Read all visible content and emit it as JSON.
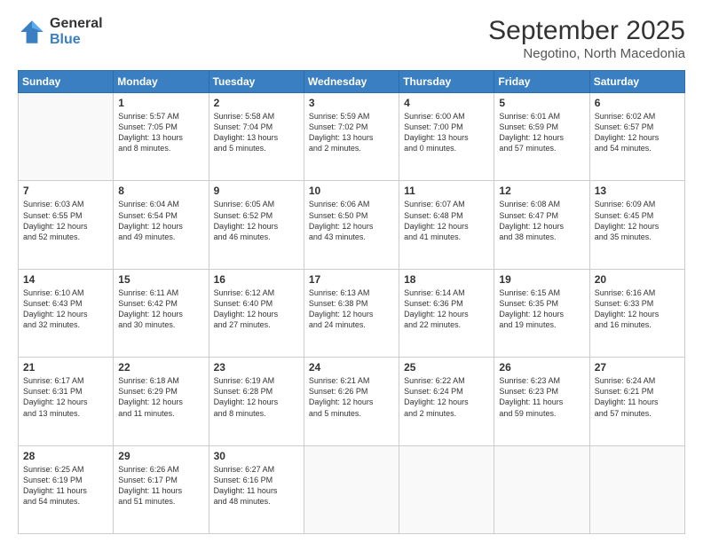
{
  "logo": {
    "general": "General",
    "blue": "Blue"
  },
  "title": {
    "month": "September 2025",
    "location": "Negotino, North Macedonia"
  },
  "weekdays": [
    "Sunday",
    "Monday",
    "Tuesday",
    "Wednesday",
    "Thursday",
    "Friday",
    "Saturday"
  ],
  "weeks": [
    [
      {
        "day": "",
        "info": ""
      },
      {
        "day": "1",
        "info": "Sunrise: 5:57 AM\nSunset: 7:05 PM\nDaylight: 13 hours\nand 8 minutes."
      },
      {
        "day": "2",
        "info": "Sunrise: 5:58 AM\nSunset: 7:04 PM\nDaylight: 13 hours\nand 5 minutes."
      },
      {
        "day": "3",
        "info": "Sunrise: 5:59 AM\nSunset: 7:02 PM\nDaylight: 13 hours\nand 2 minutes."
      },
      {
        "day": "4",
        "info": "Sunrise: 6:00 AM\nSunset: 7:00 PM\nDaylight: 13 hours\nand 0 minutes."
      },
      {
        "day": "5",
        "info": "Sunrise: 6:01 AM\nSunset: 6:59 PM\nDaylight: 12 hours\nand 57 minutes."
      },
      {
        "day": "6",
        "info": "Sunrise: 6:02 AM\nSunset: 6:57 PM\nDaylight: 12 hours\nand 54 minutes."
      }
    ],
    [
      {
        "day": "7",
        "info": "Sunrise: 6:03 AM\nSunset: 6:55 PM\nDaylight: 12 hours\nand 52 minutes."
      },
      {
        "day": "8",
        "info": "Sunrise: 6:04 AM\nSunset: 6:54 PM\nDaylight: 12 hours\nand 49 minutes."
      },
      {
        "day": "9",
        "info": "Sunrise: 6:05 AM\nSunset: 6:52 PM\nDaylight: 12 hours\nand 46 minutes."
      },
      {
        "day": "10",
        "info": "Sunrise: 6:06 AM\nSunset: 6:50 PM\nDaylight: 12 hours\nand 43 minutes."
      },
      {
        "day": "11",
        "info": "Sunrise: 6:07 AM\nSunset: 6:48 PM\nDaylight: 12 hours\nand 41 minutes."
      },
      {
        "day": "12",
        "info": "Sunrise: 6:08 AM\nSunset: 6:47 PM\nDaylight: 12 hours\nand 38 minutes."
      },
      {
        "day": "13",
        "info": "Sunrise: 6:09 AM\nSunset: 6:45 PM\nDaylight: 12 hours\nand 35 minutes."
      }
    ],
    [
      {
        "day": "14",
        "info": "Sunrise: 6:10 AM\nSunset: 6:43 PM\nDaylight: 12 hours\nand 32 minutes."
      },
      {
        "day": "15",
        "info": "Sunrise: 6:11 AM\nSunset: 6:42 PM\nDaylight: 12 hours\nand 30 minutes."
      },
      {
        "day": "16",
        "info": "Sunrise: 6:12 AM\nSunset: 6:40 PM\nDaylight: 12 hours\nand 27 minutes."
      },
      {
        "day": "17",
        "info": "Sunrise: 6:13 AM\nSunset: 6:38 PM\nDaylight: 12 hours\nand 24 minutes."
      },
      {
        "day": "18",
        "info": "Sunrise: 6:14 AM\nSunset: 6:36 PM\nDaylight: 12 hours\nand 22 minutes."
      },
      {
        "day": "19",
        "info": "Sunrise: 6:15 AM\nSunset: 6:35 PM\nDaylight: 12 hours\nand 19 minutes."
      },
      {
        "day": "20",
        "info": "Sunrise: 6:16 AM\nSunset: 6:33 PM\nDaylight: 12 hours\nand 16 minutes."
      }
    ],
    [
      {
        "day": "21",
        "info": "Sunrise: 6:17 AM\nSunset: 6:31 PM\nDaylight: 12 hours\nand 13 minutes."
      },
      {
        "day": "22",
        "info": "Sunrise: 6:18 AM\nSunset: 6:29 PM\nDaylight: 12 hours\nand 11 minutes."
      },
      {
        "day": "23",
        "info": "Sunrise: 6:19 AM\nSunset: 6:28 PM\nDaylight: 12 hours\nand 8 minutes."
      },
      {
        "day": "24",
        "info": "Sunrise: 6:21 AM\nSunset: 6:26 PM\nDaylight: 12 hours\nand 5 minutes."
      },
      {
        "day": "25",
        "info": "Sunrise: 6:22 AM\nSunset: 6:24 PM\nDaylight: 12 hours\nand 2 minutes."
      },
      {
        "day": "26",
        "info": "Sunrise: 6:23 AM\nSunset: 6:23 PM\nDaylight: 11 hours\nand 59 minutes."
      },
      {
        "day": "27",
        "info": "Sunrise: 6:24 AM\nSunset: 6:21 PM\nDaylight: 11 hours\nand 57 minutes."
      }
    ],
    [
      {
        "day": "28",
        "info": "Sunrise: 6:25 AM\nSunset: 6:19 PM\nDaylight: 11 hours\nand 54 minutes."
      },
      {
        "day": "29",
        "info": "Sunrise: 6:26 AM\nSunset: 6:17 PM\nDaylight: 11 hours\nand 51 minutes."
      },
      {
        "day": "30",
        "info": "Sunrise: 6:27 AM\nSunset: 6:16 PM\nDaylight: 11 hours\nand 48 minutes."
      },
      {
        "day": "",
        "info": ""
      },
      {
        "day": "",
        "info": ""
      },
      {
        "day": "",
        "info": ""
      },
      {
        "day": "",
        "info": ""
      }
    ]
  ]
}
